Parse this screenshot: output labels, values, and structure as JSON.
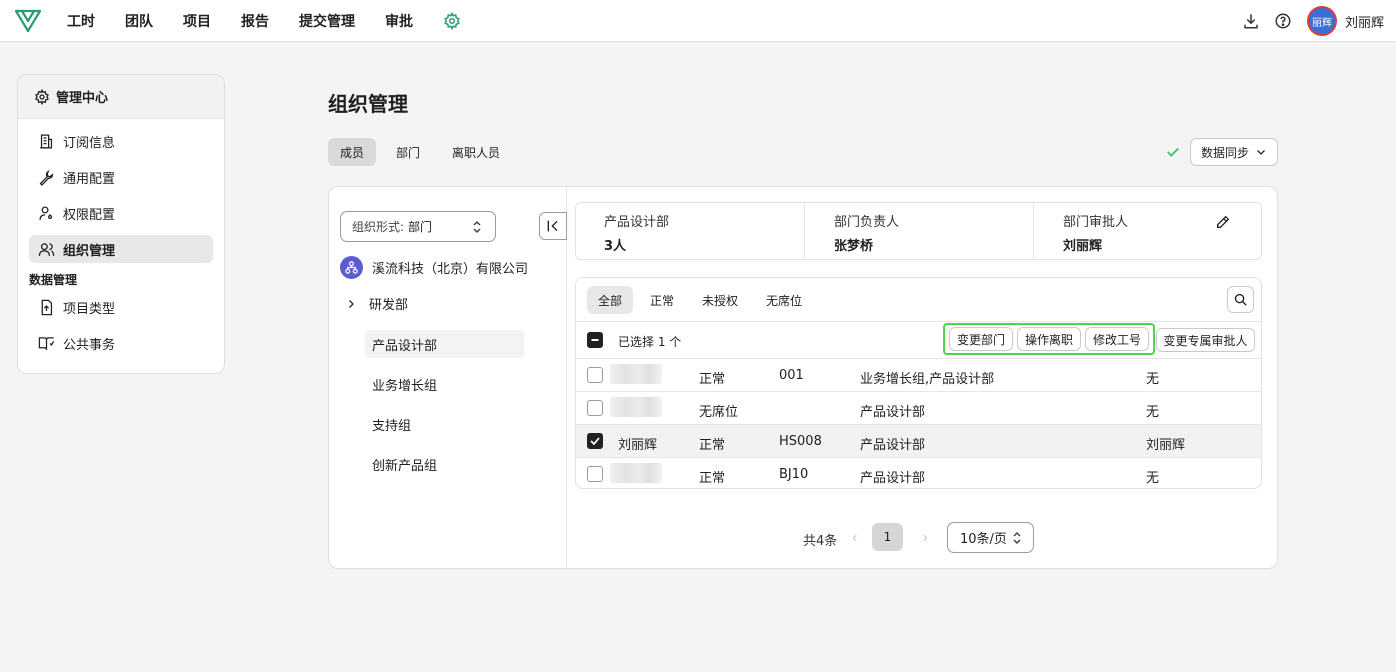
{
  "nav": {
    "items": [
      "工时",
      "团队",
      "项目",
      "报告",
      "提交管理",
      "审批"
    ],
    "user_name": "刘丽辉",
    "avatar_text": "丽辉"
  },
  "sidebar": {
    "header": "管理中心",
    "items": [
      "订阅信息",
      "通用配置",
      "权限配置",
      "组织管理"
    ],
    "section_title": "数据管理",
    "section_items": [
      "项目类型",
      "公共事务"
    ]
  },
  "main": {
    "title": "组织管理",
    "tabs": [
      "成员",
      "部门",
      "离职人员"
    ],
    "sync_label": "数据同步"
  },
  "org": {
    "select_label": "组织形式:",
    "select_value": "部门",
    "company": "溪流科技（北京）有限公司",
    "tree": [
      "研发部",
      "产品设计部",
      "业务增长组",
      "支持组",
      "创新产品组"
    ]
  },
  "dept_info": {
    "name": "产品设计部",
    "count": "3人",
    "leader_label": "部门负责人",
    "leader": "张梦桥",
    "approver_label": "部门审批人",
    "approver": "刘丽辉"
  },
  "filters": [
    "全部",
    "正常",
    "未授权",
    "无席位"
  ],
  "selection": {
    "text": "已选择 1 个",
    "actions": [
      "变更部门",
      "操作离职",
      "修改工号"
    ],
    "extra_action": "变更专属审批人"
  },
  "rows": [
    {
      "name": "",
      "status": "正常",
      "id": "001",
      "dept": "业务增长组,产品设计部",
      "approver": "无"
    },
    {
      "name": "",
      "status": "无席位",
      "id": "",
      "dept": "产品设计部",
      "approver": "无"
    },
    {
      "name": "刘丽辉",
      "status": "正常",
      "id": "HS008",
      "dept": "产品设计部",
      "approver": "刘丽辉"
    },
    {
      "name": "",
      "status": "正常",
      "id": "BJ10",
      "dept": "产品设计部",
      "approver": "无"
    }
  ],
  "pagination": {
    "total": "共4条",
    "page": "1",
    "page_size": "10条/页"
  },
  "colors": {
    "accent_green": "#4ad84a",
    "check_green": "#3fb96b",
    "gear_green": "#2a9d6e"
  }
}
